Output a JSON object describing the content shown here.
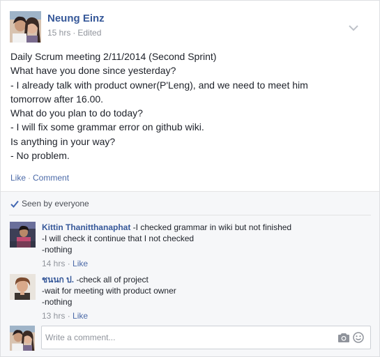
{
  "post": {
    "author": "Neung Einz",
    "time": "15 hrs",
    "separator": "·",
    "edited": "Edited",
    "options_icon": "chevron-down-icon",
    "lines": [
      "Daily Scrum meeting 2/11/2014 (Second Sprint)",
      "What have you done since yesterday?",
      "- I already talk with product owner(P'Leng), and we need to meet him",
      "tomorrow after 16.00.",
      "What do you plan to do today?",
      "- I will fix some grammar error on github wiki.",
      "Is anything in your way?",
      "- No problem."
    ],
    "actions": {
      "like": "Like",
      "dot": "·",
      "comment": "Comment"
    }
  },
  "feedback": {
    "seen_icon": "checkmark-icon",
    "seen_text": "Seen by everyone",
    "comments": [
      {
        "name": "Kittin Thanitthanaphat",
        "first_line": " -I checked grammar in wiki but not finished",
        "lines": [
          "-I will check it continue that I not checked",
          "-nothing"
        ],
        "time": "14 hrs",
        "dot": "·",
        "like": "Like"
      },
      {
        "name": "ชนนก ป.",
        "first_line": " -check all of project",
        "lines": [
          "-wait for meeting with product owner",
          "-nothing"
        ],
        "time": "13 hrs",
        "dot": "·",
        "like": "Like"
      }
    ]
  },
  "composer": {
    "placeholder": "Write a comment...",
    "camera_icon": "camera-icon",
    "emoji_icon": "smiley-icon"
  },
  "colors": {
    "link": "#365899",
    "muted": "#90949c",
    "action": "#4b6aa8",
    "feedback_bg": "#f6f7f9"
  }
}
